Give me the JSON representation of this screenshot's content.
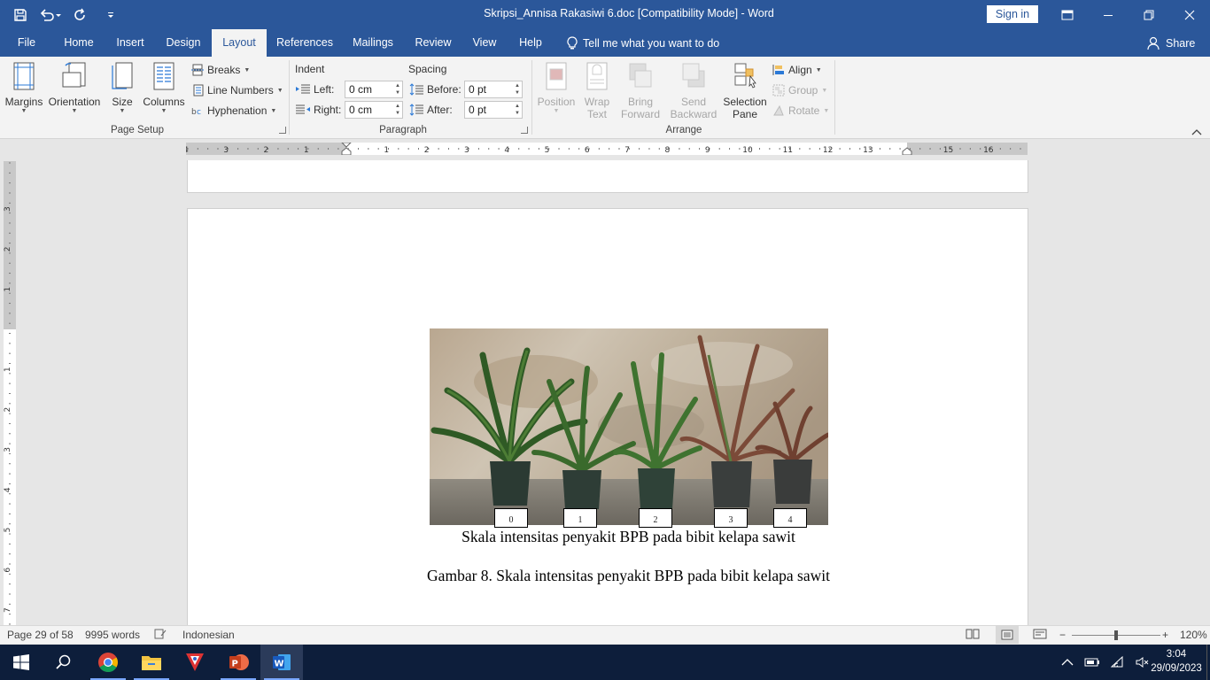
{
  "titlebar": {
    "doc_title": "Skripsi_Annisa Rakasiwi 6.doc  [Compatibility Mode]  -  Word",
    "signin_label": "Sign in"
  },
  "tabs": [
    {
      "label": "File"
    },
    {
      "label": "Home"
    },
    {
      "label": "Insert"
    },
    {
      "label": "Design"
    },
    {
      "label": "Layout"
    },
    {
      "label": "References"
    },
    {
      "label": "Mailings"
    },
    {
      "label": "Review"
    },
    {
      "label": "View"
    },
    {
      "label": "Help"
    }
  ],
  "active_tab": "Layout",
  "tellme": "Tell me what you want to do",
  "share": "Share",
  "ribbon": {
    "page_setup": {
      "label": "Page Setup",
      "margins": "Margins",
      "orientation": "Orientation",
      "size": "Size",
      "columns": "Columns",
      "breaks": "Breaks",
      "line_numbers": "Line Numbers",
      "hyphenation": "Hyphenation"
    },
    "paragraph": {
      "label": "Paragraph",
      "indent": "Indent",
      "spacing": "Spacing",
      "left_label": "Left:",
      "left_value": "0 cm",
      "right_label": "Right:",
      "right_value": "0 cm",
      "before_label": "Before:",
      "before_value": "0 pt",
      "after_label": "After:",
      "after_value": "0 pt"
    },
    "arrange": {
      "label": "Arrange",
      "position": "Position",
      "wrap_text_1": "Wrap",
      "wrap_text_2": "Text",
      "bring_forward_1": "Bring",
      "bring_forward_2": "Forward",
      "send_backward_1": "Send",
      "send_backward_2": "Backward",
      "selection_pane_1": "Selection",
      "selection_pane_2": "Pane",
      "align": "Align",
      "group": "Group",
      "rotate": "Rotate"
    }
  },
  "ruler": {
    "h_numbers": [
      "4",
      "3",
      "2",
      "1",
      "1",
      "2",
      "3",
      "4",
      "5",
      "6",
      "7",
      "8",
      "9",
      "10",
      "11",
      "12",
      "13",
      "15",
      "16"
    ],
    "v_numbers": [
      "3",
      "2",
      "1",
      "1",
      "2",
      "3",
      "4",
      "5",
      "6",
      "7"
    ]
  },
  "document": {
    "scale_labels": [
      "0",
      "1",
      "2",
      "3",
      "4"
    ],
    "image_caption": "Skala intensitas penyakit BPB pada bibit kelapa sawit",
    "figure_caption": "Gambar 8. Skala intensitas penyakit BPB pada bibit kelapa sawit"
  },
  "statusbar": {
    "page": "Page 29 of 58",
    "words": "9995 words",
    "language": "Indonesian",
    "zoom": "120%"
  },
  "taskbar": {
    "time": "3:04",
    "date": "29/09/2023"
  }
}
